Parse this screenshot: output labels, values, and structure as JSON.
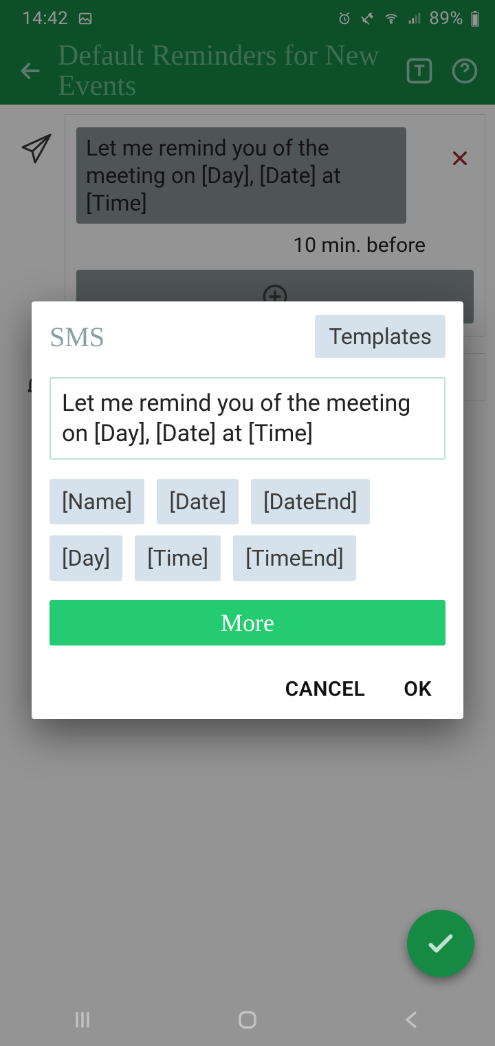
{
  "statusbar": {
    "time": "14:42",
    "battery": "89%"
  },
  "appbar": {
    "title": "Default Reminders for New Events"
  },
  "reminders": {
    "sms": {
      "message": "Let me remind  you of the meeting on [Day], [Date] at [Time]",
      "timing": "10 min. before"
    }
  },
  "dialog": {
    "title": "SMS",
    "templates_label": "Templates",
    "input_value": "Let me remind  you of the meeting on [Day], [Date] at [Time]",
    "chips": [
      "[Name]",
      "[Date]",
      "[DateEnd]",
      "[Day]",
      "[Time]",
      "[TimeEnd]"
    ],
    "more_label": "More",
    "cancel_label": "CANCEL",
    "ok_label": "OK"
  }
}
